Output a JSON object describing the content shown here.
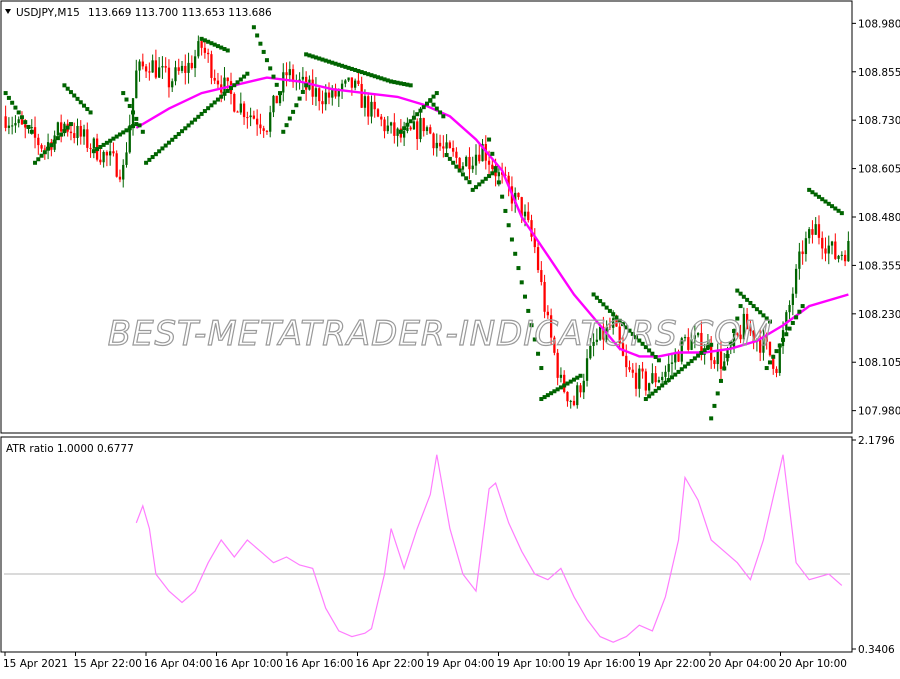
{
  "main_panel": {
    "symbol_label": "USDJPY,M15",
    "ohlc_label": "113.669 113.700 113.653 113.686",
    "watermark": "BEST-METATRADER-INDICATORS.COM"
  },
  "sub_panel": {
    "title_label": "ATR ratio 1.0000 0.6777"
  },
  "chart_data": [
    {
      "type": "candlestick",
      "title": "USDJPY,M15",
      "ylim": [
        107.93,
        109.03
      ],
      "y_ticks": [
        "108.980",
        "108.855",
        "108.730",
        "108.605",
        "108.480",
        "108.355",
        "108.230",
        "108.105",
        "107.980"
      ],
      "x_ticks": [
        "15 Apr 2021",
        "15 Apr 22:00",
        "16 Apr 04:00",
        "16 Apr 10:00",
        "16 Apr 16:00",
        "16 Apr 22:00",
        "19 Apr 04:00",
        "19 Apr 10:00",
        "19 Apr 16:00",
        "19 Apr 22:00",
        "20 Apr 04:00",
        "20 Apr 10:00"
      ],
      "colors": {
        "bull": "#006400",
        "bear": "#ff0000",
        "moving_average": "#ff00ff",
        "parabolic_sar": "#006400"
      },
      "close_path": [
        [
          0,
          108.74
        ],
        [
          6,
          108.7
        ],
        [
          12,
          108.66
        ],
        [
          18,
          108.72
        ],
        [
          24,
          108.68
        ],
        [
          30,
          108.64
        ],
        [
          36,
          108.6
        ],
        [
          40,
          108.85
        ],
        [
          44,
          108.88
        ],
        [
          50,
          108.83
        ],
        [
          56,
          108.87
        ],
        [
          60,
          108.92
        ],
        [
          64,
          108.85
        ],
        [
          70,
          108.78
        ],
        [
          76,
          108.74
        ],
        [
          80,
          108.72
        ],
        [
          86,
          108.85
        ],
        [
          94,
          108.8
        ],
        [
          100,
          108.79
        ],
        [
          106,
          108.82
        ],
        [
          112,
          108.75
        ],
        [
          118,
          108.7
        ],
        [
          122,
          108.68
        ],
        [
          128,
          108.72
        ],
        [
          134,
          108.65
        ],
        [
          140,
          108.62
        ],
        [
          146,
          108.66
        ],
        [
          152,
          108.57
        ],
        [
          158,
          108.5
        ],
        [
          162,
          108.4
        ],
        [
          166,
          108.2
        ],
        [
          170,
          108.05
        ],
        [
          174,
          108.0
        ],
        [
          180,
          108.15
        ],
        [
          186,
          108.2
        ],
        [
          190,
          108.08
        ],
        [
          196,
          108.05
        ],
        [
          202,
          108.08
        ],
        [
          208,
          108.16
        ],
        [
          214,
          108.15
        ],
        [
          220,
          108.1
        ],
        [
          226,
          108.2
        ],
        [
          232,
          108.15
        ],
        [
          236,
          108.1
        ],
        [
          240,
          108.25
        ],
        [
          244,
          108.4
        ],
        [
          248,
          108.45
        ],
        [
          254,
          108.38
        ],
        [
          258,
          108.4
        ]
      ],
      "moving_average": [
        [
          40,
          108.71
        ],
        [
          50,
          108.76
        ],
        [
          60,
          108.8
        ],
        [
          70,
          108.82
        ],
        [
          80,
          108.84
        ],
        [
          90,
          108.83
        ],
        [
          100,
          108.81
        ],
        [
          110,
          108.8
        ],
        [
          120,
          108.79
        ],
        [
          128,
          108.77
        ],
        [
          136,
          108.74
        ],
        [
          144,
          108.68
        ],
        [
          152,
          108.6
        ],
        [
          158,
          108.48
        ],
        [
          166,
          108.38
        ],
        [
          174,
          108.28
        ],
        [
          182,
          108.2
        ],
        [
          188,
          108.14
        ],
        [
          194,
          108.12
        ],
        [
          200,
          108.12
        ],
        [
          206,
          108.13
        ],
        [
          214,
          108.13
        ],
        [
          222,
          108.14
        ],
        [
          230,
          108.16
        ],
        [
          238,
          108.2
        ],
        [
          246,
          108.25
        ],
        [
          258,
          108.28
        ]
      ],
      "psar_segments": [
        {
          "from": [
            0,
            108.8
          ],
          "to": [
            8,
            108.7
          ]
        },
        {
          "from": [
            9,
            108.62
          ],
          "to": [
            20,
            108.72
          ]
        },
        {
          "from": [
            18,
            108.82
          ],
          "to": [
            26,
            108.75
          ]
        },
        {
          "from": [
            27,
            108.65
          ],
          "to": [
            40,
            108.72
          ]
        },
        {
          "from": [
            36,
            108.8
          ],
          "to": [
            42,
            108.7
          ]
        },
        {
          "from": [
            43,
            108.62
          ],
          "to": [
            74,
            108.85
          ]
        },
        {
          "from": [
            60,
            108.94
          ],
          "to": [
            68,
            108.91
          ]
        },
        {
          "from": [
            76,
            108.97
          ],
          "to": [
            84,
            108.8
          ]
        },
        {
          "from": [
            85,
            108.7
          ],
          "to": [
            92,
            108.82
          ]
        },
        {
          "from": [
            92,
            108.9
          ],
          "to": [
            118,
            108.83
          ]
        },
        {
          "from": [
            118,
            108.83
          ],
          "to": [
            124,
            108.82
          ]
        },
        {
          "from": [
            121,
            108.7
          ],
          "to": [
            132,
            108.8
          ]
        },
        {
          "from": [
            130,
            108.78
          ],
          "to": [
            134,
            108.74
          ]
        },
        {
          "from": [
            135,
            108.64
          ],
          "to": [
            142,
            108.57
          ]
        },
        {
          "from": [
            143,
            108.55
          ],
          "to": [
            150,
            108.6
          ]
        },
        {
          "from": [
            148,
            108.68
          ],
          "to": [
            164,
            108.09
          ]
        },
        {
          "from": [
            164,
            108.01
          ],
          "to": [
            176,
            108.07
          ]
        },
        {
          "from": [
            180,
            108.28
          ],
          "to": [
            200,
            108.11
          ]
        },
        {
          "from": [
            196,
            108.01
          ],
          "to": [
            216,
            108.15
          ]
        },
        {
          "from": [
            216,
            107.96
          ],
          "to": [
            225,
            108.25
          ]
        },
        {
          "from": [
            224,
            108.29
          ],
          "to": [
            234,
            108.21
          ]
        },
        {
          "from": [
            233,
            108.09
          ],
          "to": [
            244,
            108.25
          ]
        },
        {
          "from": [
            246,
            108.55
          ],
          "to": [
            256,
            108.49
          ]
        }
      ]
    },
    {
      "type": "line",
      "title": "ATR ratio 1.0000 0.6777",
      "ylim": [
        0.3406,
        2.1796
      ],
      "y_ticks": [
        "2.1796",
        "0.3406"
      ],
      "reference_level": 1.0,
      "series": [
        {
          "color": "#ff7dff",
          "values": [
            [
              40,
              1.45
            ],
            [
              42,
              1.6
            ],
            [
              44,
              1.4
            ],
            [
              46,
              1.0
            ],
            [
              50,
              0.85
            ],
            [
              54,
              0.75
            ],
            [
              58,
              0.85
            ],
            [
              62,
              1.1
            ],
            [
              66,
              1.3
            ],
            [
              70,
              1.15
            ],
            [
              74,
              1.3
            ],
            [
              78,
              1.2
            ],
            [
              82,
              1.1
            ],
            [
              86,
              1.15
            ],
            [
              90,
              1.08
            ],
            [
              94,
              1.05
            ],
            [
              98,
              0.7
            ],
            [
              102,
              0.5
            ],
            [
              106,
              0.45
            ],
            [
              110,
              0.48
            ],
            [
              112,
              0.52
            ],
            [
              116,
              1.0
            ],
            [
              118,
              1.4
            ],
            [
              122,
              1.05
            ],
            [
              126,
              1.4
            ],
            [
              130,
              1.7
            ],
            [
              132,
              2.05
            ],
            [
              136,
              1.4
            ],
            [
              140,
              1.0
            ],
            [
              144,
              0.85
            ],
            [
              146,
              1.3
            ],
            [
              148,
              1.75
            ],
            [
              150,
              1.8
            ],
            [
              154,
              1.45
            ],
            [
              158,
              1.2
            ],
            [
              162,
              1.0
            ],
            [
              166,
              0.95
            ],
            [
              170,
              1.05
            ],
            [
              174,
              0.8
            ],
            [
              178,
              0.6
            ],
            [
              182,
              0.45
            ],
            [
              186,
              0.4
            ],
            [
              190,
              0.45
            ],
            [
              194,
              0.55
            ],
            [
              198,
              0.5
            ],
            [
              202,
              0.8
            ],
            [
              206,
              1.3
            ],
            [
              208,
              1.85
            ],
            [
              212,
              1.65
            ],
            [
              216,
              1.3
            ],
            [
              220,
              1.2
            ],
            [
              224,
              1.1
            ],
            [
              228,
              0.95
            ],
            [
              232,
              1.3
            ],
            [
              236,
              1.8
            ],
            [
              238,
              2.05
            ],
            [
              242,
              1.1
            ],
            [
              246,
              0.95
            ],
            [
              252,
              1.0
            ],
            [
              256,
              0.9
            ]
          ]
        }
      ]
    }
  ]
}
